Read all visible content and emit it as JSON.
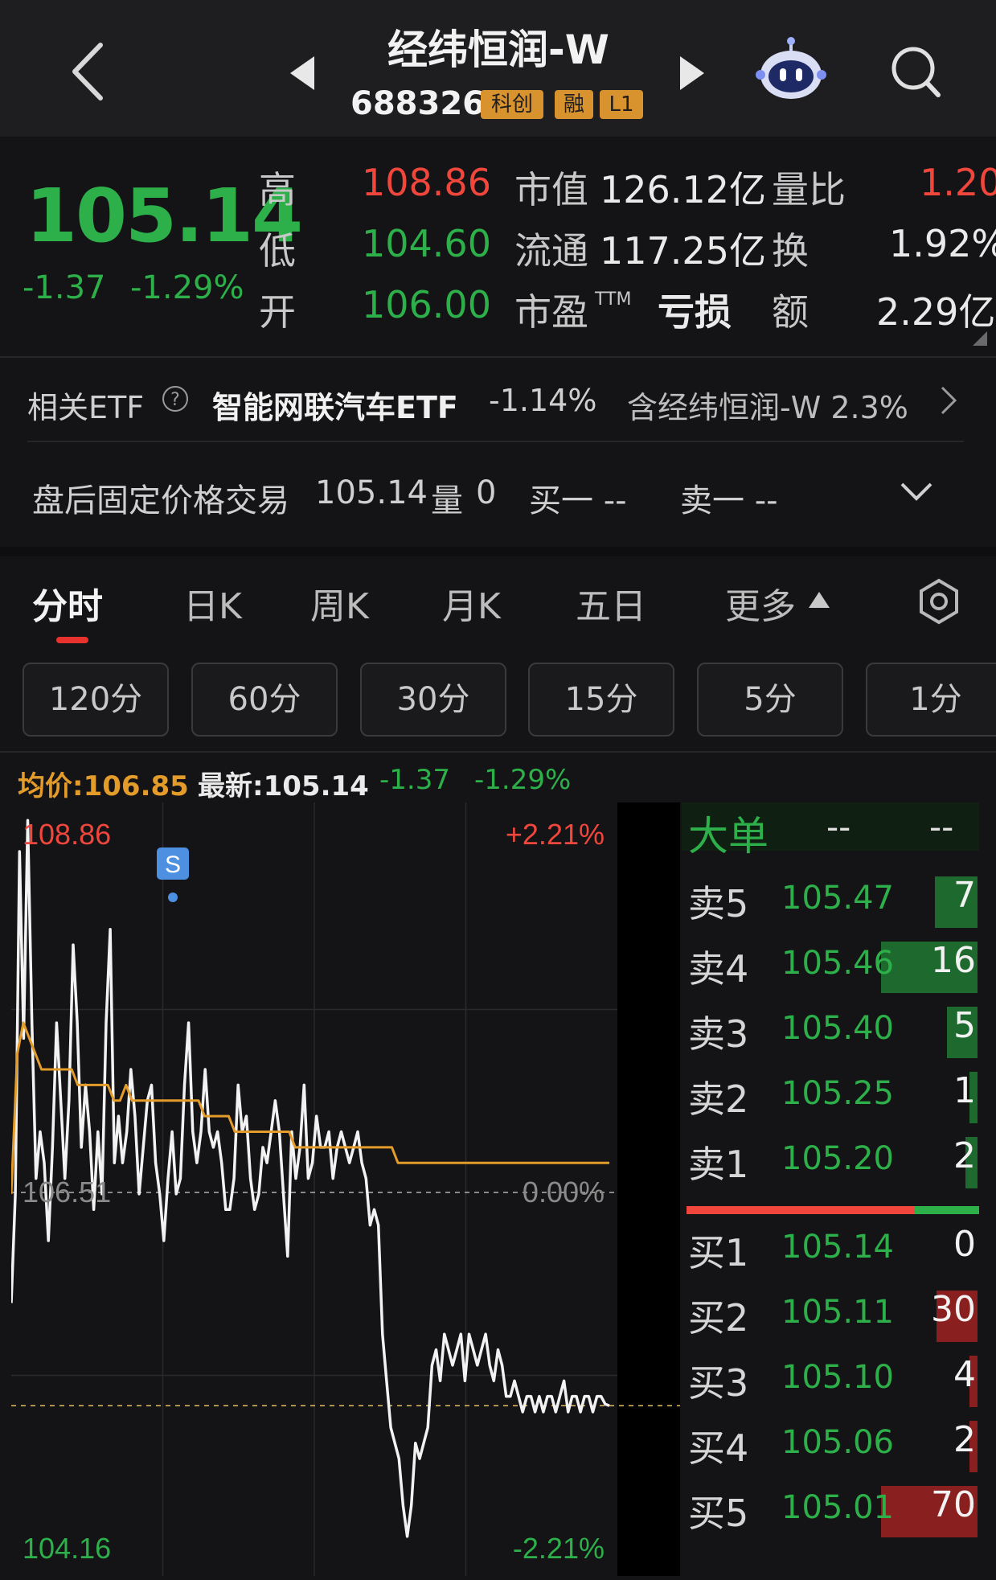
{
  "header": {
    "title": "经纬恒润-W",
    "code": "688326",
    "badges": [
      "科创",
      "融",
      "L1"
    ]
  },
  "quote": {
    "price": "105.14",
    "change": "-1.37",
    "change_pct": "-1.29%",
    "high_label": "高",
    "high": "108.86",
    "low_label": "低",
    "low": "104.60",
    "open_label": "开",
    "open": "106.00",
    "mktcap_label": "市值",
    "mktcap": "126.12亿",
    "float_label": "流通",
    "float": "117.25亿",
    "pe_label": "市盈",
    "pe_sup": "TTM",
    "pe": "亏损",
    "vol_ratio_label": "量比",
    "vol_ratio": "1.20",
    "turnover_label": "换",
    "turnover": "1.92%",
    "amount_label": "额",
    "amount": "2.29亿"
  },
  "etf": {
    "label": "相关ETF",
    "name": "智能网联汽车ETF",
    "change": "-1.14%",
    "holding": "含经纬恒润-W 2.3%"
  },
  "after_hours": {
    "label": "盘后固定价格交易",
    "price": "105.14",
    "vol_label": "量",
    "vol": "0",
    "buy": "买一 --",
    "sell": "卖一 --"
  },
  "tabs": [
    "分时",
    "日K",
    "周K",
    "月K",
    "五日",
    "更多"
  ],
  "periods": [
    "120分",
    "60分",
    "30分",
    "15分",
    "5分",
    "1分"
  ],
  "stats": {
    "avg": "均价:106.85",
    "latest": "最新:105.14",
    "change": "-1.37",
    "change_pct": "-1.29%"
  },
  "chart_data": {
    "type": "line",
    "ylim": [
      104.16,
      108.86
    ],
    "ref_price": 106.51,
    "labels": {
      "top_price": "108.86",
      "top_pct": "+2.21%",
      "mid_price": "106.51",
      "mid_pct": "0.00%",
      "bottom_price": "104.16",
      "bottom_pct": "-2.21%",
      "marker": "S"
    },
    "series": [
      {
        "color": "#f2f2f2",
        "values": [
          105.8,
          106.5,
          108.7,
          107.5,
          108.9,
          107.6,
          106.6,
          106.9,
          106.7,
          106.2,
          106.8,
          107.6,
          107.1,
          106.6,
          107.1,
          108.1,
          107.6,
          106.8,
          107.2,
          106.9,
          106.4,
          106.9,
          106.5,
          107.6,
          108.2,
          106.7,
          107.0,
          106.7,
          106.9,
          107.3,
          107.0,
          106.5,
          106.8,
          107.1,
          107.2,
          106.7,
          106.5,
          106.2,
          106.6,
          106.9,
          106.5,
          106.6,
          107.2,
          107.6,
          106.9,
          106.7,
          106.9,
          107.3,
          106.9,
          106.8,
          106.9,
          106.7,
          106.4,
          106.4,
          106.6,
          107.2,
          106.9,
          107.0,
          106.6,
          106.4,
          106.5,
          106.8,
          106.7,
          106.9,
          107.1,
          106.9,
          106.5,
          106.1,
          106.9,
          106.6,
          106.8,
          107.2,
          106.6,
          106.7,
          107.0,
          106.8,
          106.8,
          106.9,
          106.6,
          106.8,
          106.9,
          106.8,
          106.7,
          106.8,
          106.9,
          106.7,
          106.6,
          106.3,
          106.4,
          106.3,
          105.6,
          105.3,
          105.0,
          104.9,
          104.8,
          104.5,
          104.3,
          104.5,
          104.9,
          104.8,
          104.9,
          105.0,
          105.4,
          105.5,
          105.3,
          105.6,
          105.5,
          105.4,
          105.5,
          105.6,
          105.3,
          105.6,
          105.5,
          105.4,
          105.5,
          105.6,
          105.4,
          105.3,
          105.5,
          105.4,
          105.2,
          105.2,
          105.3,
          105.2,
          105.1,
          105.2,
          105.2,
          105.1,
          105.2,
          105.1,
          105.2,
          105.2,
          105.1,
          105.2,
          105.3,
          105.1,
          105.2,
          105.2,
          105.1,
          105.2,
          105.2,
          105.1,
          105.2,
          105.2,
          105.15,
          105.14
        ]
      },
      {
        "color": "#e39b2a",
        "values": [
          106.5,
          107.4,
          107.6,
          107.5,
          107.4,
          107.3,
          107.3,
          107.3,
          107.3,
          107.3,
          107.3,
          107.2,
          107.2,
          107.2,
          107.2,
          107.2,
          107.2,
          107.1,
          107.1,
          107.2,
          107.1,
          107.1,
          107.1,
          107.1,
          107.1,
          107.1,
          107.1,
          107.1,
          107.1,
          107.1,
          107.1,
          107.1,
          107.0,
          107.0,
          107.0,
          107.0,
          107.0,
          106.9,
          106.9,
          106.9,
          106.9,
          106.9,
          106.9,
          106.9,
          106.9,
          106.9,
          106.9,
          106.8,
          106.8,
          106.8,
          106.8,
          106.8,
          106.8,
          106.8,
          106.8,
          106.8,
          106.8,
          106.8,
          106.8,
          106.8,
          106.8,
          106.8,
          106.8,
          106.8,
          106.7,
          106.7,
          106.7,
          106.7,
          106.7,
          106.7,
          106.7,
          106.7,
          106.7,
          106.7,
          106.7,
          106.7,
          106.7,
          106.7,
          106.7,
          106.7,
          106.7,
          106.7,
          106.7,
          106.7,
          106.7,
          106.7,
          106.7,
          106.7,
          106.7,
          106.7,
          106.7,
          106.7,
          106.7,
          106.7,
          106.7,
          106.7,
          106.7,
          106.7,
          106.7,
          106.7
        ]
      }
    ]
  },
  "orderbook": {
    "big_order_label": "大单",
    "big_order_v1": "--",
    "big_order_v2": "--",
    "asks": [
      {
        "label": "卖5",
        "price": "105.47",
        "qty": "7"
      },
      {
        "label": "卖4",
        "price": "105.46",
        "qty": "16"
      },
      {
        "label": "卖3",
        "price": "105.40",
        "qty": "5"
      },
      {
        "label": "卖2",
        "price": "105.25",
        "qty": "1"
      },
      {
        "label": "卖1",
        "price": "105.20",
        "qty": "2"
      }
    ],
    "bids": [
      {
        "label": "买1",
        "price": "105.14",
        "qty": "0"
      },
      {
        "label": "买2",
        "price": "105.11",
        "qty": "30"
      },
      {
        "label": "买3",
        "price": "105.10",
        "qty": "4"
      },
      {
        "label": "买4",
        "price": "105.06",
        "qty": "2"
      },
      {
        "label": "买5",
        "price": "105.01",
        "qty": "70"
      }
    ],
    "ratio_bar_red_fraction": 0.78
  }
}
